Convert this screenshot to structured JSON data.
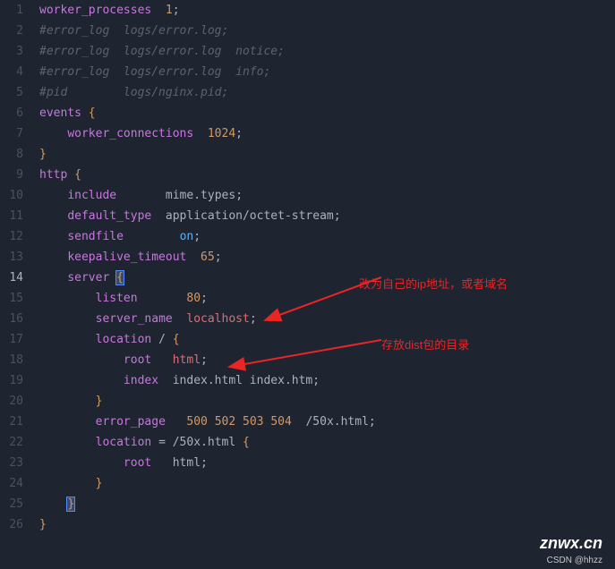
{
  "lines": [
    {
      "num": "1",
      "tokens": [
        [
          "tok-key",
          "worker_processes"
        ],
        [
          "tok-plain",
          "  "
        ],
        [
          "tok-num",
          "1"
        ],
        [
          "tok-punct",
          ";"
        ]
      ]
    },
    {
      "num": "2",
      "tokens": [
        [
          "tok-comment",
          "#error_log  logs/error.log;"
        ]
      ]
    },
    {
      "num": "3",
      "tokens": [
        [
          "tok-comment",
          "#error_log  logs/error.log  notice;"
        ]
      ]
    },
    {
      "num": "4",
      "tokens": [
        [
          "tok-comment",
          "#error_log  logs/error.log  info;"
        ]
      ]
    },
    {
      "num": "5",
      "tokens": [
        [
          "tok-comment",
          "#pid        logs/nginx.pid;"
        ]
      ]
    },
    {
      "num": "6",
      "tokens": [
        [
          "tok-key",
          "events"
        ],
        [
          "tok-plain",
          " "
        ],
        [
          "tok-brace",
          "{"
        ]
      ]
    },
    {
      "num": "7",
      "tokens": [
        [
          "tok-plain",
          "    "
        ],
        [
          "tok-key",
          "worker_connections"
        ],
        [
          "tok-plain",
          "  "
        ],
        [
          "tok-num",
          "1024"
        ],
        [
          "tok-punct",
          ";"
        ]
      ]
    },
    {
      "num": "8",
      "tokens": [
        [
          "tok-brace",
          "}"
        ]
      ]
    },
    {
      "num": "9",
      "tokens": [
        [
          "tok-key",
          "http"
        ],
        [
          "tok-plain",
          " "
        ],
        [
          "tok-brace",
          "{"
        ]
      ]
    },
    {
      "num": "10",
      "tokens": [
        [
          "tok-plain",
          "    "
        ],
        [
          "tok-key",
          "include"
        ],
        [
          "tok-plain",
          "       "
        ],
        [
          "tok-plain",
          "mime.types"
        ],
        [
          "tok-punct",
          ";"
        ]
      ]
    },
    {
      "num": "11",
      "tokens": [
        [
          "tok-plain",
          "    "
        ],
        [
          "tok-key",
          "default_type"
        ],
        [
          "tok-plain",
          "  "
        ],
        [
          "tok-plain",
          "application/octet-stream"
        ],
        [
          "tok-punct",
          ";"
        ]
      ]
    },
    {
      "num": "12",
      "tokens": [
        [
          "tok-plain",
          "    "
        ],
        [
          "tok-key",
          "sendfile"
        ],
        [
          "tok-plain",
          "        "
        ],
        [
          "tok-blue",
          "on"
        ],
        [
          "tok-punct",
          ";"
        ]
      ]
    },
    {
      "num": "13",
      "tokens": [
        [
          "tok-plain",
          "    "
        ],
        [
          "tok-key",
          "keepalive_timeout"
        ],
        [
          "tok-plain",
          "  "
        ],
        [
          "tok-num",
          "65"
        ],
        [
          "tok-punct",
          ";"
        ]
      ]
    },
    {
      "num": "14",
      "active": true,
      "tokens": [
        [
          "tok-plain",
          "    "
        ],
        [
          "tok-key",
          "server"
        ],
        [
          "tok-plain",
          " "
        ],
        [
          "cursor-highlight tok-brace",
          "{"
        ]
      ]
    },
    {
      "num": "15",
      "tokens": [
        [
          "tok-plain",
          "        "
        ],
        [
          "tok-key",
          "listen"
        ],
        [
          "tok-plain",
          "       "
        ],
        [
          "tok-num",
          "80"
        ],
        [
          "tok-punct",
          ";"
        ]
      ]
    },
    {
      "num": "16",
      "tokens": [
        [
          "tok-plain",
          "        "
        ],
        [
          "tok-key",
          "server_name"
        ],
        [
          "tok-plain",
          "  "
        ],
        [
          "tok-ident",
          "localhost"
        ],
        [
          "tok-punct",
          ";"
        ]
      ]
    },
    {
      "num": "17",
      "tokens": [
        [
          "tok-plain",
          "        "
        ],
        [
          "tok-key",
          "location"
        ],
        [
          "tok-plain",
          " "
        ],
        [
          "tok-plain",
          "/"
        ],
        [
          "tok-plain",
          " "
        ],
        [
          "tok-brace",
          "{"
        ]
      ]
    },
    {
      "num": "18",
      "tokens": [
        [
          "tok-plain",
          "            "
        ],
        [
          "tok-key",
          "root"
        ],
        [
          "tok-plain",
          "   "
        ],
        [
          "tok-ident",
          "html"
        ],
        [
          "tok-punct",
          ";"
        ]
      ]
    },
    {
      "num": "19",
      "tokens": [
        [
          "tok-plain",
          "            "
        ],
        [
          "tok-key",
          "index"
        ],
        [
          "tok-plain",
          "  "
        ],
        [
          "tok-plain",
          "index.html index.htm"
        ],
        [
          "tok-punct",
          ";"
        ]
      ]
    },
    {
      "num": "20",
      "tokens": [
        [
          "tok-plain",
          "        "
        ],
        [
          "tok-brace",
          "}"
        ]
      ]
    },
    {
      "num": "21",
      "tokens": [
        [
          "tok-plain",
          "        "
        ],
        [
          "tok-key",
          "error_page"
        ],
        [
          "tok-plain",
          "   "
        ],
        [
          "tok-num",
          "500"
        ],
        [
          "tok-plain",
          " "
        ],
        [
          "tok-num",
          "502"
        ],
        [
          "tok-plain",
          " "
        ],
        [
          "tok-num",
          "503"
        ],
        [
          "tok-plain",
          " "
        ],
        [
          "tok-num",
          "504"
        ],
        [
          "tok-plain",
          "  "
        ],
        [
          "tok-plain",
          "/50x.html"
        ],
        [
          "tok-punct",
          ";"
        ]
      ]
    },
    {
      "num": "22",
      "tokens": [
        [
          "tok-plain",
          "        "
        ],
        [
          "tok-key",
          "location"
        ],
        [
          "tok-plain",
          " "
        ],
        [
          "tok-plain",
          "= /50x.html"
        ],
        [
          "tok-plain",
          " "
        ],
        [
          "tok-brace",
          "{"
        ]
      ]
    },
    {
      "num": "23",
      "tokens": [
        [
          "tok-plain",
          "            "
        ],
        [
          "tok-key",
          "root"
        ],
        [
          "tok-plain",
          "   "
        ],
        [
          "tok-plain",
          "html"
        ],
        [
          "tok-punct",
          ";"
        ]
      ]
    },
    {
      "num": "24",
      "tokens": [
        [
          "tok-plain",
          "        "
        ],
        [
          "tok-brace",
          "}"
        ]
      ]
    },
    {
      "num": "25",
      "tokens": [
        [
          "tok-plain",
          "    "
        ],
        [
          "cursor-highlight tok-brace",
          "}"
        ]
      ]
    },
    {
      "num": "26",
      "tokens": [
        [
          "tok-brace",
          "}"
        ]
      ]
    }
  ],
  "annotations": {
    "ip_comment": "改为自己的ip地址，或者域名",
    "dist_comment": "存放dist包的目录"
  },
  "watermark": {
    "main": "znwx.cn",
    "sub": "CSDN @hhzz"
  }
}
